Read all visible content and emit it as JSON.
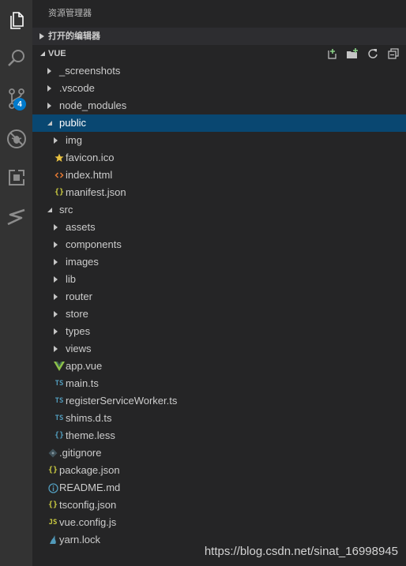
{
  "explorer": {
    "title": "资源管理器",
    "open_editors_label": "打开的编辑器",
    "folder_label": "VUE"
  },
  "activity": {
    "scm_badge": "4"
  },
  "tree": [
    {
      "label": "_screenshots",
      "kind": "folder",
      "depth": 0,
      "expanded": false
    },
    {
      "label": ".vscode",
      "kind": "folder",
      "depth": 0,
      "expanded": false
    },
    {
      "label": "node_modules",
      "kind": "folder",
      "depth": 0,
      "expanded": false
    },
    {
      "label": "public",
      "kind": "folder",
      "depth": 0,
      "expanded": true,
      "selected": true
    },
    {
      "label": "img",
      "kind": "folder",
      "depth": 1,
      "expanded": false
    },
    {
      "label": "favicon.ico",
      "kind": "file",
      "icon": "star-icon",
      "depth": 1
    },
    {
      "label": "index.html",
      "kind": "file",
      "icon": "html-icon",
      "depth": 1
    },
    {
      "label": "manifest.json",
      "kind": "file",
      "icon": "json-icon",
      "depth": 1
    },
    {
      "label": "src",
      "kind": "folder",
      "depth": 0,
      "expanded": true
    },
    {
      "label": "assets",
      "kind": "folder",
      "depth": 1,
      "expanded": false
    },
    {
      "label": "components",
      "kind": "folder",
      "depth": 1,
      "expanded": false
    },
    {
      "label": "images",
      "kind": "folder",
      "depth": 1,
      "expanded": false
    },
    {
      "label": "lib",
      "kind": "folder",
      "depth": 1,
      "expanded": false
    },
    {
      "label": "router",
      "kind": "folder",
      "depth": 1,
      "expanded": false
    },
    {
      "label": "store",
      "kind": "folder",
      "depth": 1,
      "expanded": false
    },
    {
      "label": "types",
      "kind": "folder",
      "depth": 1,
      "expanded": false
    },
    {
      "label": "views",
      "kind": "folder",
      "depth": 1,
      "expanded": false
    },
    {
      "label": "app.vue",
      "kind": "file",
      "icon": "vue-icon",
      "depth": 1
    },
    {
      "label": "main.ts",
      "kind": "file",
      "icon": "ts-icon",
      "depth": 1
    },
    {
      "label": "registerServiceWorker.ts",
      "kind": "file",
      "icon": "ts-icon",
      "depth": 1
    },
    {
      "label": "shims.d.ts",
      "kind": "file",
      "icon": "ts-icon",
      "depth": 1
    },
    {
      "label": "theme.less",
      "kind": "file",
      "icon": "less-icon",
      "depth": 1
    },
    {
      "label": ".gitignore",
      "kind": "file",
      "icon": "git-icon",
      "depth": 0
    },
    {
      "label": "package.json",
      "kind": "file",
      "icon": "json-icon",
      "depth": 0
    },
    {
      "label": "README.md",
      "kind": "file",
      "icon": "info-icon",
      "depth": 0
    },
    {
      "label": "tsconfig.json",
      "kind": "file",
      "icon": "json-icon",
      "depth": 0
    },
    {
      "label": "vue.config.js",
      "kind": "file",
      "icon": "js-icon",
      "depth": 0
    },
    {
      "label": "yarn.lock",
      "kind": "file",
      "icon": "yarn-icon",
      "depth": 0
    }
  ],
  "watermark": "https://blog.csdn.net/sinat_16998945"
}
